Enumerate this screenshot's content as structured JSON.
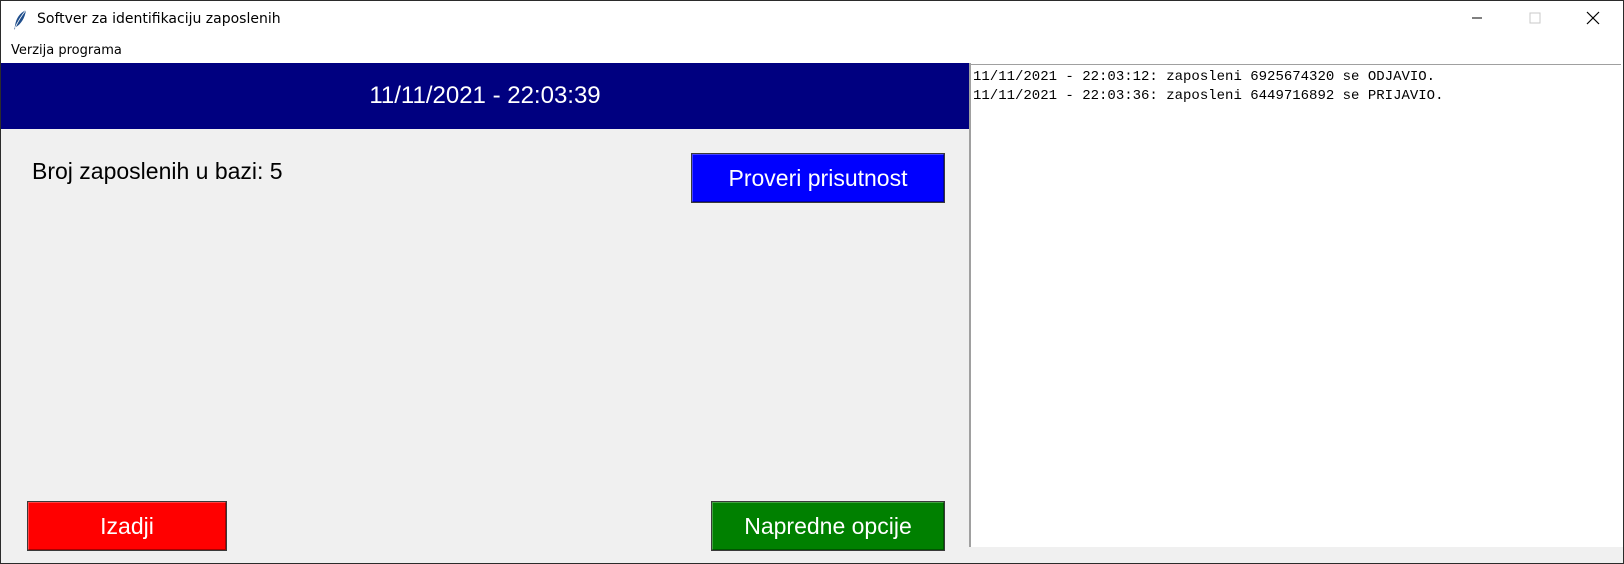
{
  "window": {
    "title": "Softver za identifikaciju zaposlenih",
    "app_icon": "feather-icon",
    "controls": {
      "minimize_icon": "minimize-icon",
      "maximize_icon": "maximize-icon",
      "close_icon": "close-icon"
    }
  },
  "menu": {
    "items": [
      "Verzija programa"
    ]
  },
  "main": {
    "datetime": "11/11/2021 - 22:03:39",
    "employee_count_text": "Broj zaposlenih u bazi: 5",
    "check_button": "Proveri prisutnost",
    "exit_button": "Izadji",
    "advanced_button": "Napredne opcije"
  },
  "log": {
    "lines": [
      "11/11/2021 - 22:03:12: zaposleni 6925674320 se ODJAVIO.",
      "11/11/2021 - 22:03:36: zaposleni 6449716892 se PRIJAVIO."
    ]
  },
  "colors": {
    "banner": "#000080",
    "check_button": "#0000ff",
    "exit_button": "#ff0000",
    "advanced_button": "#008000",
    "panel_bg": "#f0f0f0"
  }
}
